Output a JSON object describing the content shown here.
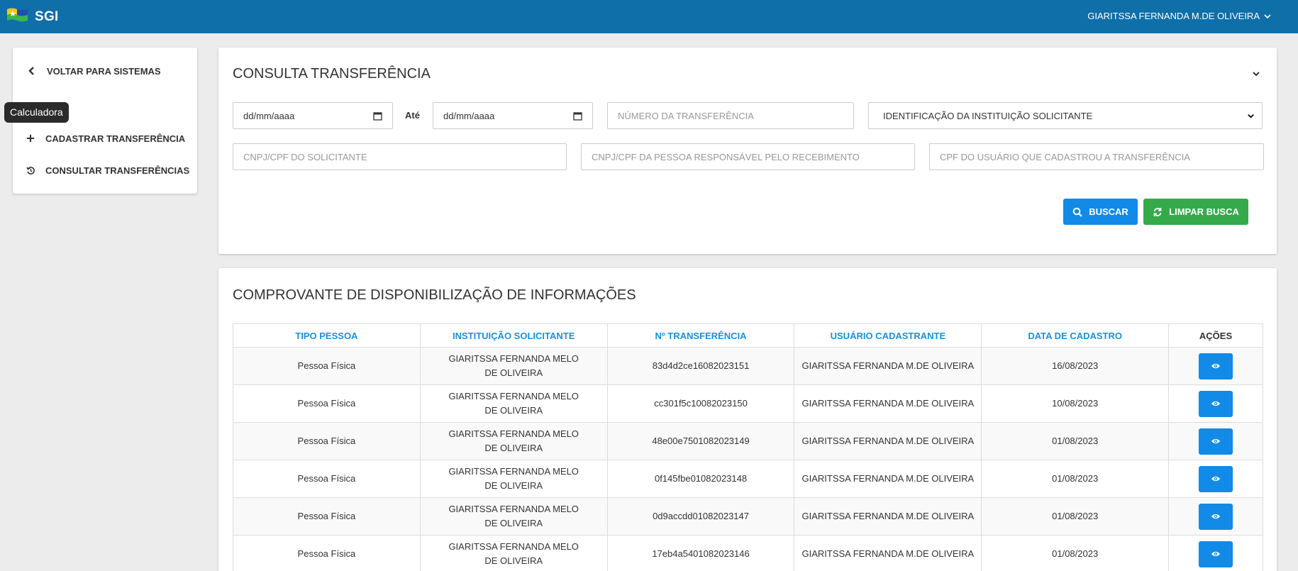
{
  "app": {
    "brand": "SGI",
    "user_name": "GIARITSSA FERNANDA M.DE OLIVEIRA"
  },
  "sidebar": {
    "back_label": "VOLTAR PARA SISTEMAS",
    "tooltip": "Calculadora",
    "items": [
      {
        "label": "CADASTRAR TRANSFERÊNCIA",
        "icon": "plus-icon"
      },
      {
        "label": "CONSULTAR TRANSFERÊNCIAS",
        "icon": "history-icon"
      }
    ]
  },
  "search": {
    "title": "CONSULTA TRANSFERÊNCIA",
    "date_from_placeholder": "dd/mm/aaaa",
    "date_separator": "Até",
    "date_to_placeholder": "dd/mm/aaaa",
    "transfer_number_placeholder": "NÚMERO DA TRANSFERÊNCIA",
    "institution_select_value": "IDENTIFICAÇÃO DA INSTITUIÇÃO SOLICITANTE",
    "requester_doc_placeholder": "CNPJ/CPF DO SOLICITANTE",
    "receiver_doc_placeholder": "CNPJ/CPF DA PESSOA RESPONSÁVEL PELO RECEBIMENTO",
    "user_cpf_placeholder": "CPF DO USUÁRIO QUE CADASTROU A TRANSFERÊNCIA",
    "search_label": "BUSCAR",
    "clear_label": "LIMPAR BUSCA"
  },
  "results": {
    "title": "COMPROVANTE DE DISPONIBILIZAÇÃO DE INFORMAÇÕES",
    "columns": [
      "TIPO PESSOA",
      "INSTITUIÇÃO SOLICITANTE",
      "Nº TRANSFERÊNCIA",
      "USUÁRIO CADASTRANTE",
      "DATA DE CADASTRO",
      "AÇÕES"
    ],
    "rows": [
      {
        "tipo": "Pessoa Física",
        "instituicao": "GIARITSSA FERNANDA MELO DE OLIVEIRA",
        "numero": "83d4d2ce16082023151",
        "usuario": "GIARITSSA FERNANDA M.DE OLIVEIRA",
        "data": "16/08/2023"
      },
      {
        "tipo": "Pessoa Física",
        "instituicao": "GIARITSSA FERNANDA MELO DE OLIVEIRA",
        "numero": "cc301f5c10082023150",
        "usuario": "GIARITSSA FERNANDA M.DE OLIVEIRA",
        "data": "10/08/2023"
      },
      {
        "tipo": "Pessoa Física",
        "instituicao": "GIARITSSA FERNANDA MELO DE OLIVEIRA",
        "numero": "48e00e7501082023149",
        "usuario": "GIARITSSA FERNANDA M.DE OLIVEIRA",
        "data": "01/08/2023"
      },
      {
        "tipo": "Pessoa Física",
        "instituicao": "GIARITSSA FERNANDA MELO DE OLIVEIRA",
        "numero": "0f145fbe01082023148",
        "usuario": "GIARITSSA FERNANDA M.DE OLIVEIRA",
        "data": "01/08/2023"
      },
      {
        "tipo": "Pessoa Física",
        "instituicao": "GIARITSSA FERNANDA MELO DE OLIVEIRA",
        "numero": "0d9accdd01082023147",
        "usuario": "GIARITSSA FERNANDA M.DE OLIVEIRA",
        "data": "01/08/2023"
      },
      {
        "tipo": "Pessoa Física",
        "instituicao": "GIARITSSA FERNANDA MELO DE OLIVEIRA",
        "numero": "17eb4a5401082023146",
        "usuario": "GIARITSSA FERNANDA M.DE OLIVEIRA",
        "data": "01/08/2023"
      }
    ]
  },
  "colors": {
    "topbar": "#0f6fa9",
    "primary": "#118be7",
    "success": "#35aa4b",
    "header_text": "#1891e0"
  },
  "icons": {
    "back": "chevron-left-icon",
    "search": "search-icon",
    "clear": "refresh-icon",
    "view": "eye-icon",
    "user_menu": "chevron-down-icon",
    "collapse": "chevron-down-icon",
    "calendar": "calendar-icon"
  }
}
